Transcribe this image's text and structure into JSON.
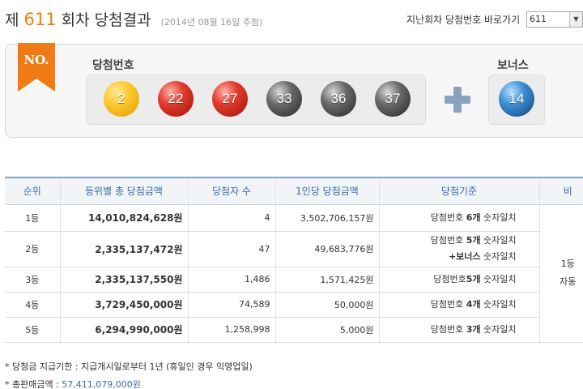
{
  "header": {
    "prefix": "제",
    "round": "611",
    "suffix": "회차 당첨결과",
    "draw_date": "(2014년 08월 16일 추첨)",
    "goto_label": "지난회차 당첨번호 바로가기",
    "goto_selected": "611"
  },
  "panel": {
    "badge": "NO.",
    "winning_label": "당첨번호",
    "bonus_label": "보너스",
    "balls": [
      {
        "value": "2",
        "color": "#f5b21c"
      },
      {
        "value": "22",
        "color": "#d7382b"
      },
      {
        "value": "27",
        "color": "#d7382b"
      },
      {
        "value": "33",
        "color": "#555555"
      },
      {
        "value": "36",
        "color": "#555555"
      },
      {
        "value": "37",
        "color": "#555555"
      }
    ],
    "bonus_ball": {
      "value": "14",
      "color": "#2f7cc6"
    }
  },
  "table": {
    "headers": [
      "순위",
      "등위별 총 당첨금액",
      "당첨자 수",
      "1인당 당첨금액",
      "당첨기준",
      "비"
    ],
    "rows": [
      {
        "rank": "1등",
        "total": "14,010,824,628원",
        "winners": "4",
        "per": "3,502,706,157원",
        "c_pre": "당첨번호 ",
        "c_bold": "6개",
        "c_post": " 숫자일치",
        "c2": ""
      },
      {
        "rank": "2등",
        "total": "2,335,137,472원",
        "winners": "47",
        "per": "49,683,776원",
        "c_pre": "당첨번호 ",
        "c_bold": "5개",
        "c_post": " 숫자일치",
        "c2_bold": "+보너스",
        "c2": " 숫자일치"
      },
      {
        "rank": "3등",
        "total": "2,335,137,550원",
        "winners": "1,486",
        "per": "1,571,425원",
        "c_pre": "당첨번호",
        "c_bold": "5개",
        "c_post": " 숫자일치",
        "c2": ""
      },
      {
        "rank": "4등",
        "total": "3,729,450,000원",
        "winners": "74,589",
        "per": "50,000원",
        "c_pre": "당첨번호 ",
        "c_bold": "4개",
        "c_post": " 숫자일치",
        "c2": ""
      },
      {
        "rank": "5등",
        "total": "6,294,990,000원",
        "winners": "1,258,998",
        "per": "5,000원",
        "c_pre": "당첨번호 ",
        "c_bold": "3개",
        "c_post": " 숫자일치",
        "c2": ""
      }
    ],
    "note_line1": "1등",
    "note_line2": "자동"
  },
  "footnotes": {
    "deadline": "* 당첨금 지급기한 : 지급개시일로부터 1년 (휴일인 경우 익영업일)",
    "sales_label": "* 총판매금액 : ",
    "sales_value": "57,411,079,000원"
  }
}
